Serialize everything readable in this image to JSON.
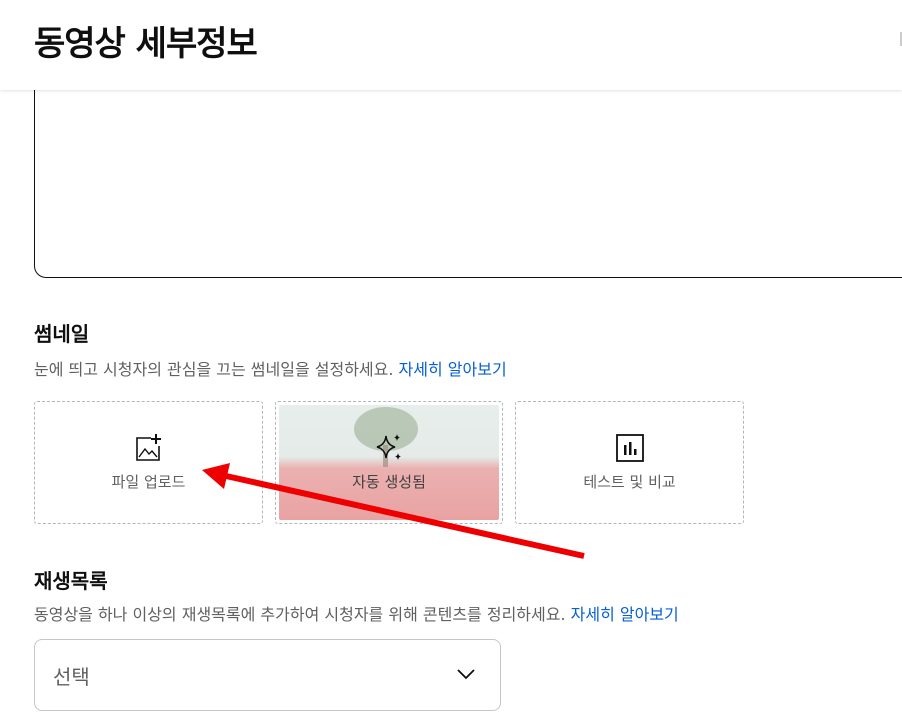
{
  "header": {
    "title": "동영상 세부정보"
  },
  "thumbnail": {
    "title": "썸네일",
    "description": "눈에 띄고 시청자의 관심을 끄는 썸네일을 설정하세요.",
    "learn_more": "자세히 알아보기",
    "options": [
      {
        "label": "파일 업로드",
        "icon": "image-add-icon"
      },
      {
        "label": "자동 생성됨",
        "icon": "sparkle-icon"
      },
      {
        "label": "테스트 및 비교",
        "icon": "bar-chart-icon"
      }
    ]
  },
  "playlist": {
    "title": "재생목록",
    "description": "동영상을 하나 이상의 재생목록에 추가하여 시청자를 위해 콘텐츠를 정리하세요.",
    "learn_more": "자세히 알아보기",
    "select_value": "선택",
    "select_icon": "chevron-down-icon"
  },
  "annotation": {
    "arrow_color": "#ee0000"
  },
  "colors": {
    "link": "#065fd4",
    "text": "#0f0f0f",
    "secondary": "#606060"
  }
}
